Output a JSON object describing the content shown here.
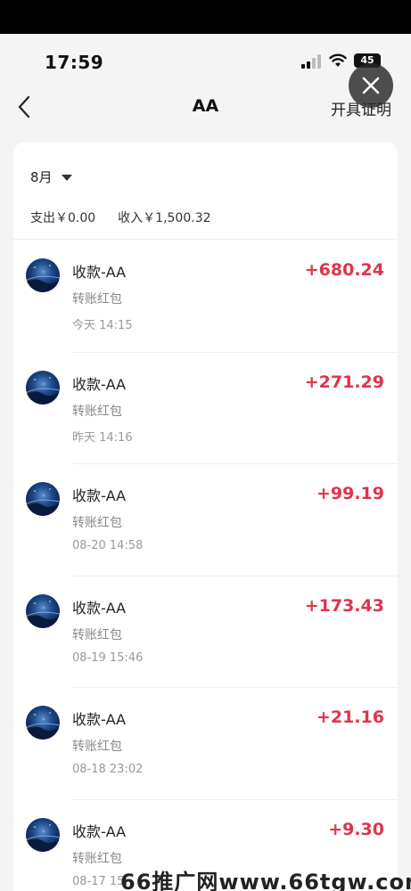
{
  "status_bar": {
    "time": "17:59",
    "battery": "45"
  },
  "nav": {
    "title": "AA",
    "action": "开具证明"
  },
  "month": {
    "label": "8月"
  },
  "summary": {
    "expense": "支出￥0.00",
    "income": "收入￥1,500.32"
  },
  "transactions": [
    {
      "title": "收款-AA",
      "subtitle": "转账红包",
      "time": "今天 14:15",
      "amount": "+680.24"
    },
    {
      "title": "收款-AA",
      "subtitle": "转账红包",
      "time": "昨天 14:16",
      "amount": "+271.29"
    },
    {
      "title": "收款-AA",
      "subtitle": "转账红包",
      "time": "08-20 14:58",
      "amount": "+99.19"
    },
    {
      "title": "收款-AA",
      "subtitle": "转账红包",
      "time": "08-19 15:46",
      "amount": "+173.43"
    },
    {
      "title": "收款-AA",
      "subtitle": "转账红包",
      "time": "08-18 23:02",
      "amount": "+21.16"
    },
    {
      "title": "收款-AA",
      "subtitle": "转账红包",
      "time": "08-17 15:",
      "amount": "+9.30"
    }
  ],
  "watermark": {
    "text": "66推广网www.66tgw.com"
  },
  "colors": {
    "amount": "#e0334d",
    "background": "#f4f4f4",
    "card": "#ffffff"
  },
  "icons": [
    "back-chevron-icon",
    "close-icon",
    "caret-down-icon",
    "signal-icon",
    "wifi-icon",
    "battery-icon"
  ]
}
